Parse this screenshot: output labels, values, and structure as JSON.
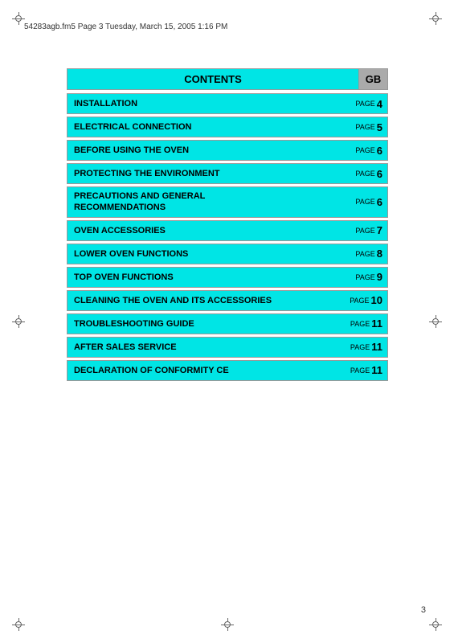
{
  "header": {
    "file_info": "54283agb.fm5  Page 3  Tuesday, March 15, 2005  1:16 PM"
  },
  "contents": {
    "title": "CONTENTS",
    "gb_label": "GB",
    "items": [
      {
        "label": "INSTALLATION",
        "page_word": "PAGE",
        "page_num": "4"
      },
      {
        "label": "ELECTRICAL CONNECTION",
        "page_word": "PAGE",
        "page_num": "5"
      },
      {
        "label": "BEFORE USING THE OVEN",
        "page_word": "PAGE",
        "page_num": "6"
      },
      {
        "label": "PROTECTING THE ENVIRONMENT",
        "page_word": "PAGE",
        "page_num": "6"
      },
      {
        "label": "PRECAUTIONS AND GENERAL\nRECOMMENDATIONS",
        "page_word": "PAGE",
        "page_num": "6",
        "two_line": true
      },
      {
        "label": "OVEN ACCESSORIES",
        "page_word": "PAGE",
        "page_num": "7"
      },
      {
        "label": "LOWER OVEN FUNCTIONS",
        "page_word": "PAGE",
        "page_num": "8"
      },
      {
        "label": "TOP OVEN FUNCTIONS",
        "page_word": "PAGE",
        "page_num": "9"
      },
      {
        "label": "CLEANING THE OVEN AND ITS ACCESSORIES",
        "page_word": "PAGE",
        "page_num": "10"
      },
      {
        "label": "TROUBLESHOOTING GUIDE",
        "page_word": "PAGE",
        "page_num": "11"
      },
      {
        "label": "AFTER SALES SERVICE",
        "page_word": "PAGE",
        "page_num": "11"
      },
      {
        "label": "DECLARATION OF CONFORMITY CE",
        "page_word": "PAGE",
        "page_num": "11"
      }
    ]
  },
  "page_number": "3"
}
